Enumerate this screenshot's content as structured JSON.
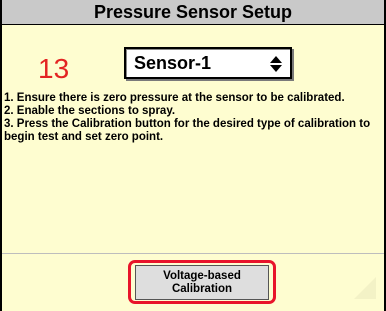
{
  "window": {
    "title": "Pressure Sensor Setup"
  },
  "step": {
    "number": "13"
  },
  "sensor_select": {
    "value": "Sensor-1",
    "arrow_icon": "up-down-arrows-icon"
  },
  "instructions": {
    "lines": [
      "1. Ensure there is zero pressure at the sensor to be calibrated.",
      "2. Enable the sections to spray.",
      "3. Press the Calibration button for the desired type of calibration to begin test and set zero point."
    ]
  },
  "calibration_button": {
    "line1": "Voltage-based",
    "line2": "Calibration"
  },
  "colors": {
    "panel_background": "#fefdd0",
    "title_background": "#c9c9c9",
    "step_number": "#e32422",
    "highlight_border": "#e8142a",
    "button_background": "#dedede"
  }
}
